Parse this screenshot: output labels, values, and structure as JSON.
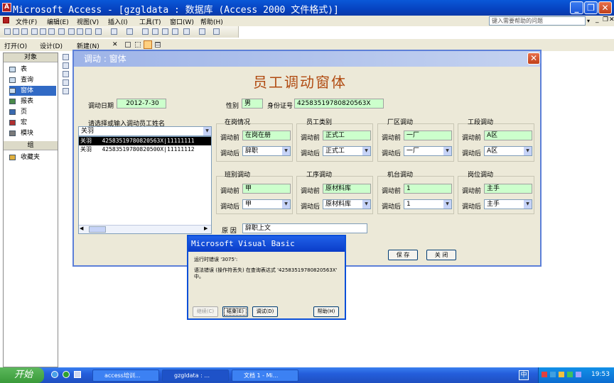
{
  "app": {
    "title": "Microsoft Access - [gzgldata : 数据库 (Access 2000 文件格式)]",
    "icon_letter": "A"
  },
  "window_buttons": {
    "minimize": "_",
    "restore": "❐",
    "close": "✕"
  },
  "menus": [
    "文件(F)",
    "编辑(E)",
    "视图(V)",
    "插入(I)",
    "工具(T)",
    "窗口(W)",
    "帮助(H)"
  ],
  "help_placeholder": "键入需要帮助的问题",
  "db_toolbar": {
    "open": "打开(O)",
    "design": "设计(D)",
    "new": "新建(N)",
    "delete": "✕"
  },
  "db_window": {
    "objects_header": "对象",
    "items": [
      "表",
      "查询",
      "窗体",
      "报表",
      "页",
      "宏",
      "模块"
    ],
    "group_header": "组",
    "favorites": "收藏夹"
  },
  "form": {
    "window_title": "调动 : 窗体",
    "heading": "员工调动窗体",
    "date_label": "调动日期",
    "date_value": "2012-7-30",
    "gender_label": "性别",
    "gender_value": "男",
    "id_label": "身份证号",
    "id_value": "42583519780820563X",
    "list_label": "请选择或输入调动员工姓名",
    "list_combo_value": "关羽",
    "list_rows": [
      {
        "name": "关羽",
        "id": "42583519780820563X",
        "code": "11111111",
        "selected": true
      },
      {
        "name": "关羽",
        "id": "42583519780820500X",
        "code": "11111112",
        "selected": false
      }
    ],
    "before_label": "调动前",
    "after_label": "调动后",
    "groups": [
      {
        "title": "在岗情况",
        "before": "在岗在册",
        "after": "辞职"
      },
      {
        "title": "员工类别",
        "before": "正式工",
        "after": "正式工"
      },
      {
        "title": "厂区调动",
        "before": "一厂",
        "after": "一厂"
      },
      {
        "title": "工段调动",
        "before": "A区",
        "after": "A区"
      },
      {
        "title": "班别调动",
        "before": "甲",
        "after": "甲"
      },
      {
        "title": "工序调动",
        "before": "原材料库",
        "after": "原材料库"
      },
      {
        "title": "机台调动",
        "before": "1",
        "after": "1"
      },
      {
        "title": "岗位调动",
        "before": "主手",
        "after": "主手"
      }
    ],
    "reason_label": "原  因",
    "reason_value": "辞职上文",
    "save_button": "保 存",
    "close_button": "关 闭"
  },
  "vb_dialog": {
    "title": "Microsoft Visual Basic",
    "error_line": "运行时错误 '3075':",
    "message": "语法错误 (操作符丢失) 在查询表达式 '42583519780820563X' 中。",
    "continue": "继续(C)",
    "end": "结束(E)",
    "debug": "调试(D)",
    "help": "帮助(H)"
  },
  "taskbar": {
    "start": "开始",
    "tasks": [
      "access培训...",
      "gzgldata : ...",
      "文档 1 - Mi..."
    ],
    "lang": "中",
    "clock": "19:53"
  }
}
